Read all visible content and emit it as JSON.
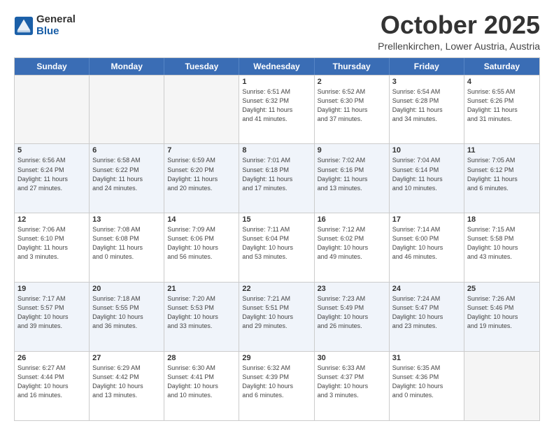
{
  "header": {
    "logo_general": "General",
    "logo_blue": "Blue",
    "month": "October 2025",
    "location": "Prellenkirchen, Lower Austria, Austria"
  },
  "weekdays": [
    "Sunday",
    "Monday",
    "Tuesday",
    "Wednesday",
    "Thursday",
    "Friday",
    "Saturday"
  ],
  "weeks": [
    [
      {
        "day": "",
        "info": ""
      },
      {
        "day": "",
        "info": ""
      },
      {
        "day": "",
        "info": ""
      },
      {
        "day": "1",
        "info": "Sunrise: 6:51 AM\nSunset: 6:32 PM\nDaylight: 11 hours\nand 41 minutes."
      },
      {
        "day": "2",
        "info": "Sunrise: 6:52 AM\nSunset: 6:30 PM\nDaylight: 11 hours\nand 37 minutes."
      },
      {
        "day": "3",
        "info": "Sunrise: 6:54 AM\nSunset: 6:28 PM\nDaylight: 11 hours\nand 34 minutes."
      },
      {
        "day": "4",
        "info": "Sunrise: 6:55 AM\nSunset: 6:26 PM\nDaylight: 11 hours\nand 31 minutes."
      }
    ],
    [
      {
        "day": "5",
        "info": "Sunrise: 6:56 AM\nSunset: 6:24 PM\nDaylight: 11 hours\nand 27 minutes."
      },
      {
        "day": "6",
        "info": "Sunrise: 6:58 AM\nSunset: 6:22 PM\nDaylight: 11 hours\nand 24 minutes."
      },
      {
        "day": "7",
        "info": "Sunrise: 6:59 AM\nSunset: 6:20 PM\nDaylight: 11 hours\nand 20 minutes."
      },
      {
        "day": "8",
        "info": "Sunrise: 7:01 AM\nSunset: 6:18 PM\nDaylight: 11 hours\nand 17 minutes."
      },
      {
        "day": "9",
        "info": "Sunrise: 7:02 AM\nSunset: 6:16 PM\nDaylight: 11 hours\nand 13 minutes."
      },
      {
        "day": "10",
        "info": "Sunrise: 7:04 AM\nSunset: 6:14 PM\nDaylight: 11 hours\nand 10 minutes."
      },
      {
        "day": "11",
        "info": "Sunrise: 7:05 AM\nSunset: 6:12 PM\nDaylight: 11 hours\nand 6 minutes."
      }
    ],
    [
      {
        "day": "12",
        "info": "Sunrise: 7:06 AM\nSunset: 6:10 PM\nDaylight: 11 hours\nand 3 minutes."
      },
      {
        "day": "13",
        "info": "Sunrise: 7:08 AM\nSunset: 6:08 PM\nDaylight: 11 hours\nand 0 minutes."
      },
      {
        "day": "14",
        "info": "Sunrise: 7:09 AM\nSunset: 6:06 PM\nDaylight: 10 hours\nand 56 minutes."
      },
      {
        "day": "15",
        "info": "Sunrise: 7:11 AM\nSunset: 6:04 PM\nDaylight: 10 hours\nand 53 minutes."
      },
      {
        "day": "16",
        "info": "Sunrise: 7:12 AM\nSunset: 6:02 PM\nDaylight: 10 hours\nand 49 minutes."
      },
      {
        "day": "17",
        "info": "Sunrise: 7:14 AM\nSunset: 6:00 PM\nDaylight: 10 hours\nand 46 minutes."
      },
      {
        "day": "18",
        "info": "Sunrise: 7:15 AM\nSunset: 5:58 PM\nDaylight: 10 hours\nand 43 minutes."
      }
    ],
    [
      {
        "day": "19",
        "info": "Sunrise: 7:17 AM\nSunset: 5:57 PM\nDaylight: 10 hours\nand 39 minutes."
      },
      {
        "day": "20",
        "info": "Sunrise: 7:18 AM\nSunset: 5:55 PM\nDaylight: 10 hours\nand 36 minutes."
      },
      {
        "day": "21",
        "info": "Sunrise: 7:20 AM\nSunset: 5:53 PM\nDaylight: 10 hours\nand 33 minutes."
      },
      {
        "day": "22",
        "info": "Sunrise: 7:21 AM\nSunset: 5:51 PM\nDaylight: 10 hours\nand 29 minutes."
      },
      {
        "day": "23",
        "info": "Sunrise: 7:23 AM\nSunset: 5:49 PM\nDaylight: 10 hours\nand 26 minutes."
      },
      {
        "day": "24",
        "info": "Sunrise: 7:24 AM\nSunset: 5:47 PM\nDaylight: 10 hours\nand 23 minutes."
      },
      {
        "day": "25",
        "info": "Sunrise: 7:26 AM\nSunset: 5:46 PM\nDaylight: 10 hours\nand 19 minutes."
      }
    ],
    [
      {
        "day": "26",
        "info": "Sunrise: 6:27 AM\nSunset: 4:44 PM\nDaylight: 10 hours\nand 16 minutes."
      },
      {
        "day": "27",
        "info": "Sunrise: 6:29 AM\nSunset: 4:42 PM\nDaylight: 10 hours\nand 13 minutes."
      },
      {
        "day": "28",
        "info": "Sunrise: 6:30 AM\nSunset: 4:41 PM\nDaylight: 10 hours\nand 10 minutes."
      },
      {
        "day": "29",
        "info": "Sunrise: 6:32 AM\nSunset: 4:39 PM\nDaylight: 10 hours\nand 6 minutes."
      },
      {
        "day": "30",
        "info": "Sunrise: 6:33 AM\nSunset: 4:37 PM\nDaylight: 10 hours\nand 3 minutes."
      },
      {
        "day": "31",
        "info": "Sunrise: 6:35 AM\nSunset: 4:36 PM\nDaylight: 10 hours\nand 0 minutes."
      },
      {
        "day": "",
        "info": ""
      }
    ]
  ]
}
